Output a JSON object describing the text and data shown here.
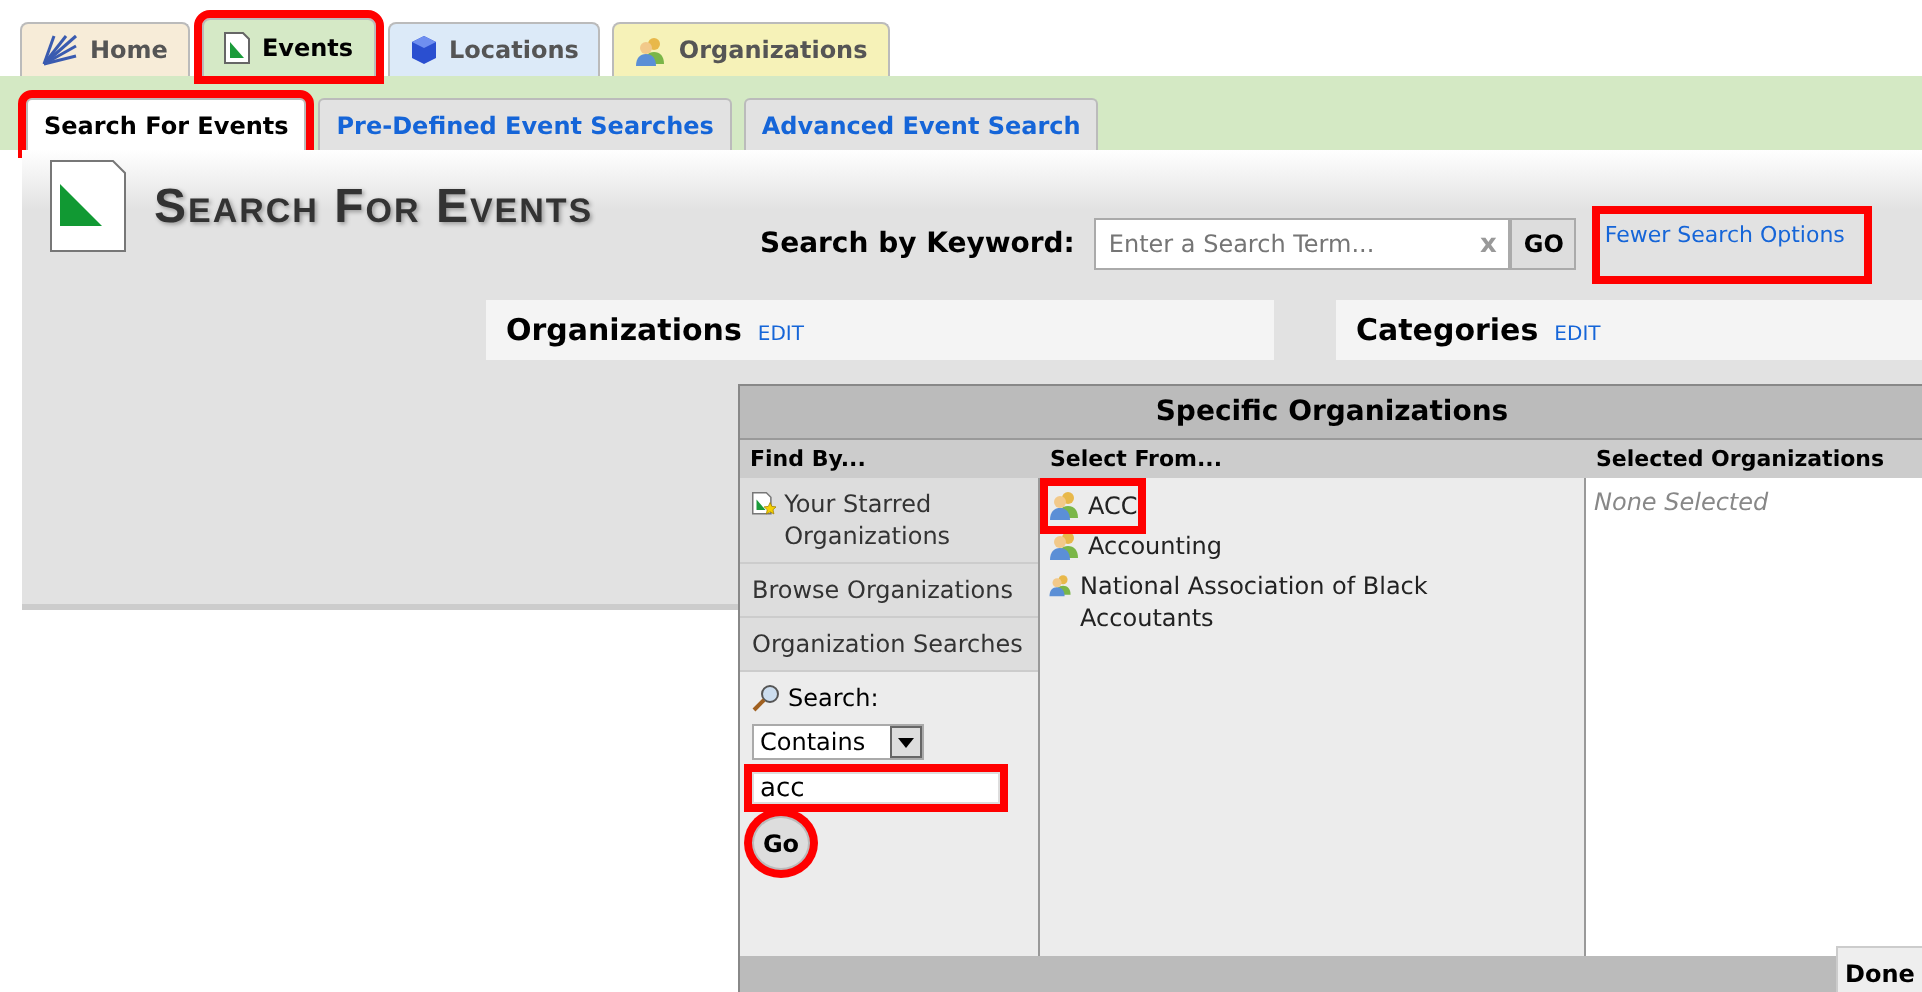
{
  "tabs": [
    {
      "label": "Home",
      "kind": "home",
      "selected": false,
      "highlighted": false
    },
    {
      "label": "Events",
      "kind": "events",
      "selected": true,
      "highlighted": true
    },
    {
      "label": "Locations",
      "kind": "locations",
      "selected": false,
      "highlighted": false
    },
    {
      "label": "Organizations",
      "kind": "organizations",
      "selected": false,
      "highlighted": false
    }
  ],
  "subtabs": [
    {
      "label": "Search For Events",
      "selected": true,
      "highlighted": true
    },
    {
      "label": "Pre-Defined Event Searches",
      "selected": false,
      "highlighted": false
    },
    {
      "label": "Advanced Event Search",
      "selected": false,
      "highlighted": false
    }
  ],
  "page_title": "Search For Events",
  "keyword_search": {
    "label": "Search by Keyword:",
    "placeholder": "Enter a Search Term...",
    "clear": "x",
    "go": "GO",
    "options_link": "Fewer Search Options",
    "options_link_highlighted": true
  },
  "panels": [
    {
      "title": "Organizations",
      "edit": "EDIT"
    },
    {
      "title": "Categories",
      "edit": "EDIT"
    }
  ],
  "dialog": {
    "title": "Specific Organizations",
    "columns": [
      "Find By...",
      "Select From...",
      "Selected Organizations"
    ],
    "find_by": [
      {
        "label": "Your Starred Organizations",
        "kind": "starred"
      },
      {
        "label": "Browse Organizations",
        "kind": "plain"
      },
      {
        "label": "Organization Searches",
        "kind": "plain"
      }
    ],
    "search_label": "Search:",
    "match": "Contains",
    "query": "acc",
    "query_highlighted": true,
    "go": "Go",
    "go_highlighted": true,
    "results": [
      {
        "label": "ACC",
        "highlighted": true
      },
      {
        "label": "Accounting",
        "highlighted": false
      },
      {
        "label": "National Association of Black Accoutants",
        "highlighted": false
      }
    ],
    "selected_placeholder": "None Selected",
    "done": "Done"
  }
}
